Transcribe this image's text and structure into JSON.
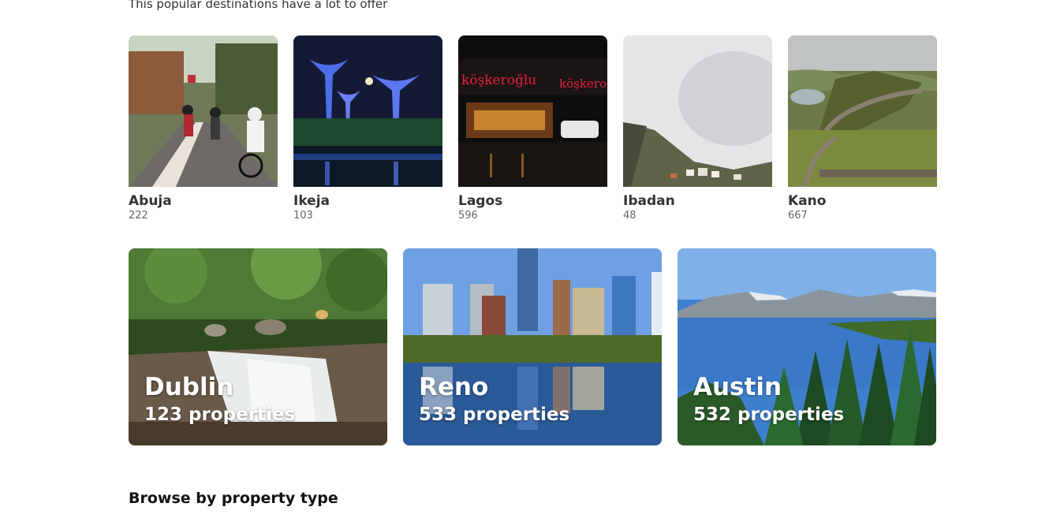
{
  "subtitle": "This popular destinations have a lot to offer",
  "small_destinations": [
    {
      "name": "Abuja",
      "count": "222",
      "image": "cyclists-street-photo"
    },
    {
      "name": "Ikeja",
      "count": "103",
      "image": "supertrees-night-photo"
    },
    {
      "name": "Lagos",
      "count": "596",
      "image": "restaurant-night-photo"
    },
    {
      "name": "Ibadan",
      "count": "48",
      "image": "misty-hill-photo"
    },
    {
      "name": "Kano",
      "count": "667",
      "image": "green-ridge-wall-photo"
    }
  ],
  "big_destinations": [
    {
      "name": "Dublin",
      "properties": "123 properties",
      "image": "forest-waterfall-photo"
    },
    {
      "name": "Reno",
      "properties": "533 properties",
      "image": "city-skyline-river-photo"
    },
    {
      "name": "Austin",
      "properties": "532 properties",
      "image": "mountain-lake-forest-photo"
    }
  ],
  "browse_title": "Browse by property type"
}
